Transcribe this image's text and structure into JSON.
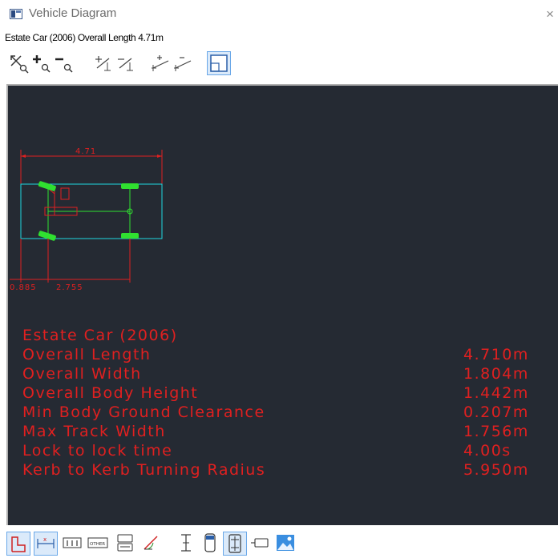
{
  "window": {
    "title": "Vehicle Diagram",
    "close_glyph": "×"
  },
  "subtitle": "Estate Car (2006)  Overall Length 4.71m",
  "drawing": {
    "dim_top": "4.71",
    "dim_bottom_left": "0.885",
    "dim_bottom_right": "2.755"
  },
  "specs": {
    "title": "Estate Car (2006)",
    "rows": [
      {
        "label": "Overall Length",
        "value": "4.710m"
      },
      {
        "label": "Overall Width",
        "value": "1.804m"
      },
      {
        "label": "Overall Body Height",
        "value": "1.442m"
      },
      {
        "label": "Min Body Ground Clearance",
        "value": "0.207m"
      },
      {
        "label": "Max Track Width",
        "value": "1.756m"
      },
      {
        "label": "Lock to lock time",
        "value": "4.00s"
      },
      {
        "label": "Kerb to Kerb Turning Radius",
        "value": "5.950m"
      }
    ]
  },
  "toolbar_top": [
    {
      "name": "zoom-extents-icon"
    },
    {
      "name": "zoom-in-icon"
    },
    {
      "name": "zoom-out-icon"
    },
    {
      "name": "add-dimension-icon"
    },
    {
      "name": "remove-dimension-icon"
    },
    {
      "name": "add-offset-dimension-icon"
    },
    {
      "name": "remove-offset-dimension-icon"
    },
    {
      "name": "frame-view-icon"
    }
  ],
  "toolbar_bottom": [
    {
      "name": "plan-view-icon"
    },
    {
      "name": "width-icon"
    },
    {
      "name": "axles-icon"
    },
    {
      "name": "other-icon",
      "label": "OTHER"
    },
    {
      "name": "side-view-icon"
    },
    {
      "name": "steering-angle-icon"
    },
    {
      "name": "height-icon"
    },
    {
      "name": "body-outline-icon"
    },
    {
      "name": "chassis-icon"
    },
    {
      "name": "trailer-icon"
    },
    {
      "name": "picture-icon"
    }
  ],
  "colors": {
    "canvas_bg": "#252a33",
    "dimension_red": "#e02020",
    "body_cyan": "#20d8e0",
    "wheel_green": "#30e030"
  }
}
